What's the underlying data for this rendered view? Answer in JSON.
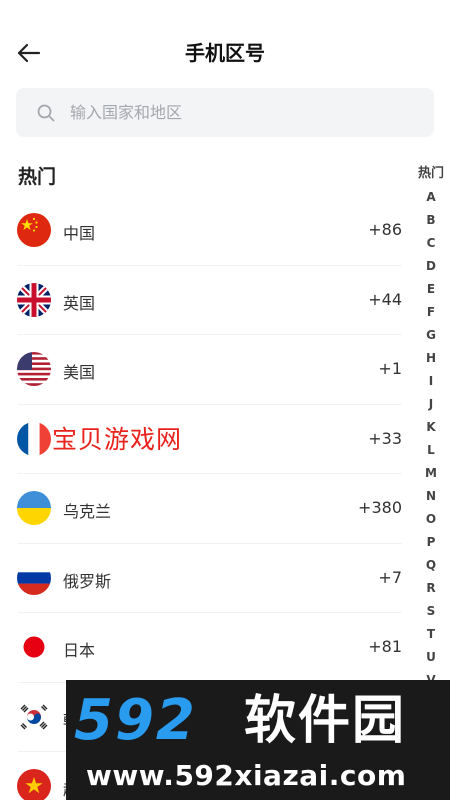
{
  "header": {
    "title": "手机区号",
    "back_icon": "arrow-left-icon"
  },
  "search": {
    "placeholder": "输入国家和地区",
    "icon": "search-icon"
  },
  "section": {
    "hot_title": "热门"
  },
  "countries": [
    {
      "name": "中国",
      "code": "+86",
      "flag": "china-flag-icon"
    },
    {
      "name": "英国",
      "code": "+44",
      "flag": "uk-flag-icon"
    },
    {
      "name": "美国",
      "code": "+1",
      "flag": "usa-flag-icon"
    },
    {
      "name": "",
      "code": "+33",
      "flag": "france-flag-icon"
    },
    {
      "name": "乌克兰",
      "code": "+380",
      "flag": "ukraine-flag-icon"
    },
    {
      "name": "俄罗斯",
      "code": "+7",
      "flag": "russia-flag-icon"
    },
    {
      "name": "日本",
      "code": "+81",
      "flag": "japan-flag-icon"
    },
    {
      "name": "韩",
      "code": "",
      "flag": "korea-flag-icon"
    },
    {
      "name": "越",
      "code": "",
      "flag": "vietnam-flag-icon"
    }
  ],
  "index_bar": {
    "hot": "热门",
    "letters": [
      "A",
      "B",
      "C",
      "D",
      "E",
      "F",
      "G",
      "H",
      "I",
      "J",
      "K",
      "L",
      "M",
      "N",
      "O",
      "P",
      "Q",
      "R",
      "S",
      "T",
      "U",
      "V"
    ]
  },
  "watermark": {
    "site_name": "宝贝游戏网",
    "banner_logo": "592",
    "banner_logo_cn": "软件园",
    "banner_url": "www.592xiazai.com"
  },
  "colors": {
    "accent_red": "#e8231b",
    "banner_blue": "#2a9cf0",
    "search_bg": "#f3f4f6"
  }
}
